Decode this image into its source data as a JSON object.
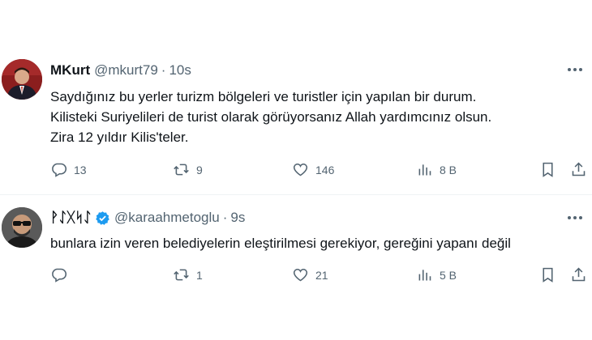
{
  "tweets": [
    {
      "name": "MKurt",
      "handle": "@mkurt79",
      "separator": "·",
      "time": "10s",
      "verified": false,
      "text_lines": [
        "Saydığınız bu yerler turizm bölgeleri ve turistler için yapılan bir durum.",
        "Kilisteki Suriyelileri de turist olarak görüyorsanız Allah yardımcınız olsun.",
        "Zira 12 yıldır Kilis'teler."
      ],
      "stats": {
        "replies": "13",
        "retweets": "9",
        "likes": "146",
        "views": "8 B"
      }
    },
    {
      "name": "ᚹᛇᚷᛋᛇ",
      "handle": "@karaahmetoglu",
      "separator": "·",
      "time": "9s",
      "verified": true,
      "text_lines": [
        "bunlara izin veren belediyelerin eleştirilmesi gerekiyor, gereğini yapanı değil"
      ],
      "stats": {
        "replies": "",
        "retweets": "1",
        "likes": "21",
        "views": "5 B"
      }
    }
  ],
  "colors": {
    "text": "#0f1419",
    "secondary": "#536471",
    "verified": "#1d9bf0",
    "divider": "#eff3f4"
  },
  "icons": [
    "reply-icon",
    "retweet-icon",
    "like-icon",
    "views-icon",
    "bookmark-icon",
    "share-icon",
    "more-icon",
    "verified-icon"
  ]
}
